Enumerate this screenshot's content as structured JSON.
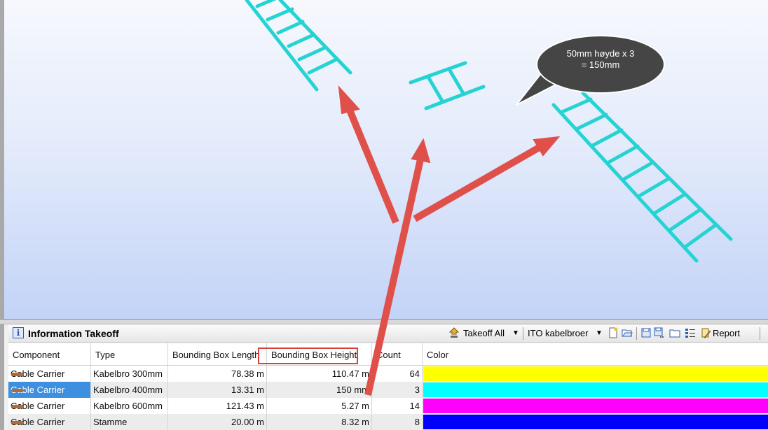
{
  "callout": {
    "line1": "50mm høyde x 3",
    "line2": "= 150mm"
  },
  "panel": {
    "title": "Information Takeoff",
    "toolbar": {
      "takeoff_all": "Takeoff All",
      "view_select": "ITO kabelbroer",
      "report": "Report"
    }
  },
  "table": {
    "columns": [
      "Component",
      "Type",
      "Bounding Box Length",
      "Bounding Box Height",
      "Count",
      "Color"
    ],
    "rows": [
      {
        "component": "Cable Carrier",
        "type": "Kabelbro 300mm",
        "length": "78.38 m",
        "height": "110.47 m",
        "count": "64",
        "color": "#ffff00",
        "selected": false
      },
      {
        "component": "Cable Carrier",
        "type": "Kabelbro 400mm",
        "length": "13.31 m",
        "height": "150 mm",
        "count": "3",
        "color": "#00ffff",
        "selected": true
      },
      {
        "component": "Cable Carrier",
        "type": "Kabelbro 600mm",
        "length": "121.43 m",
        "height": "5.27 m",
        "count": "14",
        "color": "#ff00ff",
        "selected": false
      },
      {
        "component": "Cable Carrier",
        "type": "Stamme",
        "length": "20.00 m",
        "height": "8.32 m",
        "count": "8",
        "color": "#0000ff",
        "selected": false
      }
    ]
  },
  "colors": {
    "cable_tray": "#26d3d3",
    "arrow": "#e0504a",
    "highlight": "#d9413c",
    "selection": "#3d8fe0"
  },
  "icons": [
    "info-icon",
    "takeoff-icon",
    "dropdown-icon",
    "new-icon",
    "open-icon",
    "save-icon",
    "save-as-icon",
    "folder-icon",
    "settings-icon",
    "report-icon"
  ]
}
